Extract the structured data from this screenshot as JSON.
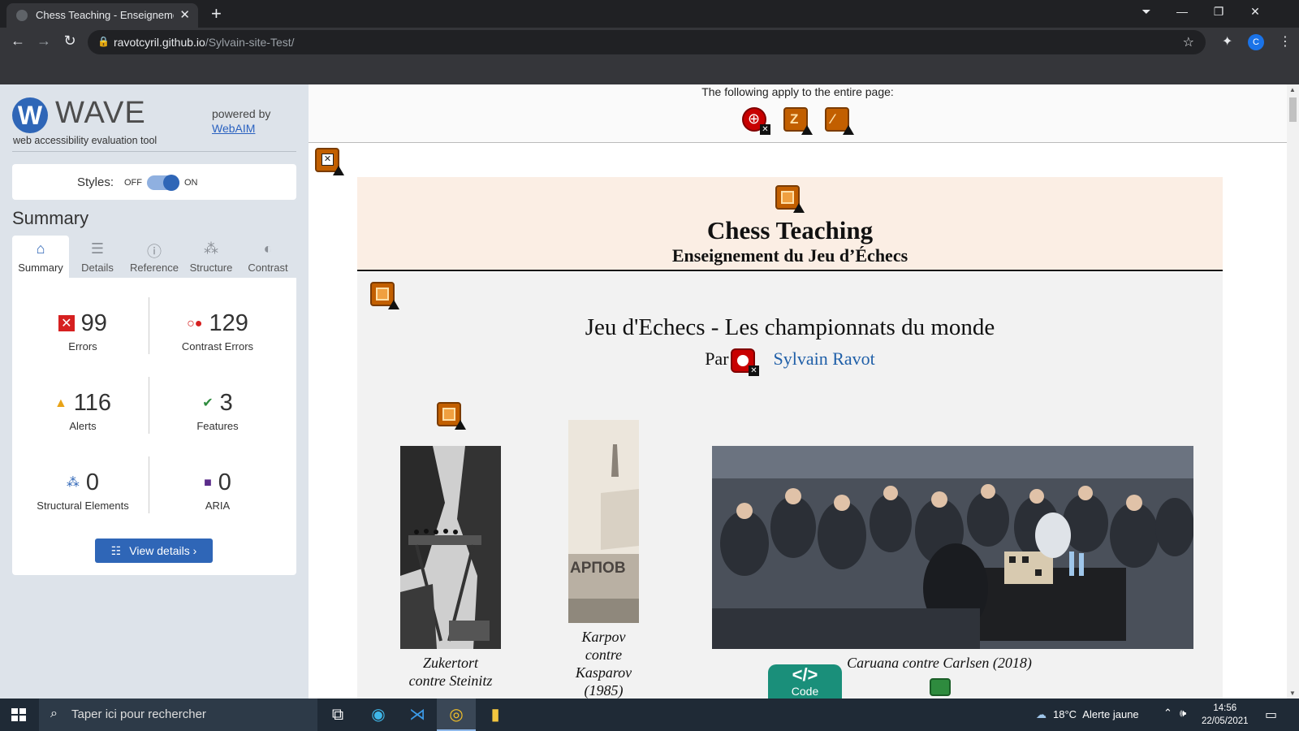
{
  "browser": {
    "tab_title": "Chess Teaching - Enseignement d",
    "tab_close": "✕",
    "new_tab": "+",
    "url_host": "ravotcyril.github.io",
    "url_path": "/Sylvain-site-Test/",
    "profile_initial": "C"
  },
  "wave": {
    "logo_letter": "W",
    "name": "WAVE",
    "tagline": "web accessibility evaluation tool",
    "powered_by": "powered by",
    "webaim": "WebAIM",
    "styles_label": "Styles:",
    "styles_off": "OFF",
    "styles_on": "ON",
    "styles_state": "on",
    "summary_heading": "Summary",
    "tabs": [
      {
        "label": "Summary",
        "icon": "home-icon",
        "active": true
      },
      {
        "label": "Details",
        "icon": "list-icon",
        "active": false
      },
      {
        "label": "Reference",
        "icon": "info-icon",
        "active": false
      },
      {
        "label": "Structure",
        "icon": "structure-icon",
        "active": false
      },
      {
        "label": "Contrast",
        "icon": "contrast-icon",
        "active": false
      }
    ],
    "stats": {
      "errors": {
        "count": "99",
        "label": "Errors",
        "icon": "error-icon",
        "color": "#d62020"
      },
      "contrast": {
        "count": "129",
        "label": "Contrast Errors",
        "icon": "contrast-error-icon",
        "color": "#d62020"
      },
      "alerts": {
        "count": "116",
        "label": "Alerts",
        "icon": "alert-icon",
        "color": "#e8a317"
      },
      "features": {
        "count": "3",
        "label": "Features",
        "icon": "feature-icon",
        "color": "#2e8b3e"
      },
      "structural": {
        "count": "0",
        "label": "Structural Elements",
        "icon": "structure-icon",
        "color": "#2f66b7"
      },
      "aria": {
        "count": "0",
        "label": "ARIA",
        "icon": "aria-icon",
        "color": "#5b2c8a"
      }
    },
    "view_details": "View details ›"
  },
  "page": {
    "apply_text": "The following apply to the entire page:",
    "site_title": "Chess Teaching",
    "site_subtitle": "Enseignement du Jeu d’Échecs",
    "heading": "Jeu d'Echecs - Les championnats du monde",
    "byline_prefix": "Par",
    "author": "Sylvain Ravot",
    "photos": [
      {
        "caption_lines": [
          "Zukertort",
          "contre Steinitz"
        ]
      },
      {
        "caption_lines": [
          "Karpov",
          "contre",
          "Kasparov",
          "(1985)"
        ],
        "inner_text": "АРПОВ"
      },
      {
        "caption_lines": [
          "Caruana contre Carlsen (2018)"
        ]
      }
    ],
    "code_icon": "</>",
    "code_label": "Code"
  },
  "taskbar": {
    "search_placeholder": "Taper ici pour rechercher",
    "weather_temp": "18°C",
    "weather_text": "Alerte jaune",
    "time": "14:56",
    "date": "22/05/2021"
  },
  "colors": {
    "wave_blue": "#2f66b7",
    "header_bg": "#fbeee4",
    "author_link": "#1f5fa8",
    "code_button": "#1a8f7a"
  }
}
